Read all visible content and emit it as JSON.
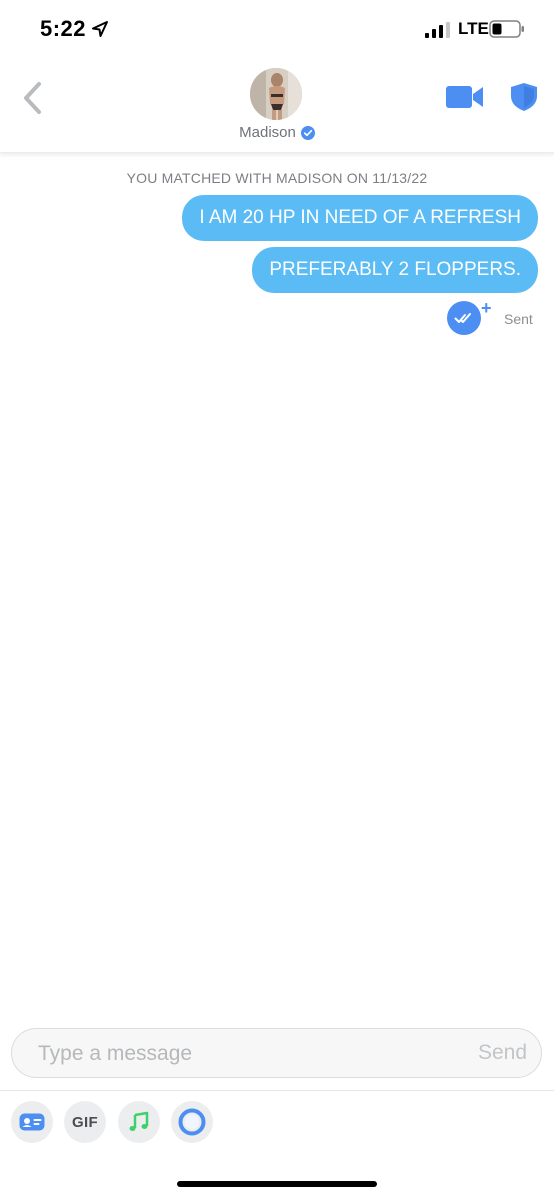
{
  "status_bar": {
    "time": "5:22",
    "network": "LTE"
  },
  "header": {
    "profile_name": "Madison",
    "verified": true,
    "icons": {
      "back": "chevron-left-icon",
      "video": "video-camera-icon",
      "safety": "shield-icon"
    }
  },
  "chat": {
    "match_banner": "YOU MATCHED WITH MADISON ON 11/13/22",
    "messages": [
      {
        "direction": "outgoing",
        "text": "I AM 20 HP IN NEED OF A REFRESH"
      },
      {
        "direction": "outgoing",
        "text": "PREFERABLY 2 FLOPPERS."
      }
    ],
    "status": "Sent"
  },
  "composer": {
    "placeholder": "Type a message",
    "send_label": "Send"
  },
  "toolbar": {
    "gif_label": "GIF",
    "items": [
      "contact-card-icon",
      "gif-icon",
      "music-note-icon",
      "circle-icon"
    ]
  },
  "colors": {
    "bubble": "#5bbcf5",
    "accent_blue": "#4c8ef1",
    "music_green": "#3fcf6b"
  }
}
